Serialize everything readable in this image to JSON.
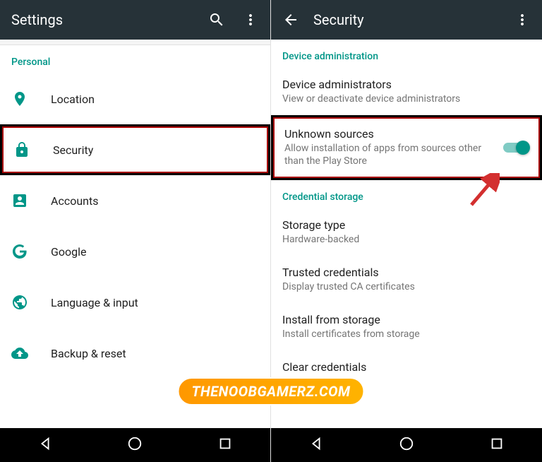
{
  "left": {
    "title": "Settings",
    "section": "Personal",
    "items": [
      {
        "label": "Location"
      },
      {
        "label": "Security"
      },
      {
        "label": "Accounts"
      },
      {
        "label": "Google"
      },
      {
        "label": "Language & input"
      },
      {
        "label": "Backup & reset"
      }
    ]
  },
  "right": {
    "title": "Security",
    "section1": "Device administration",
    "section2": "Credential storage",
    "items": {
      "devadmin": {
        "title": "Device administrators",
        "subtitle": "View or deactivate device administrators"
      },
      "unknown": {
        "title": "Unknown sources",
        "subtitle": "Allow installation of apps from sources other than the Play Store"
      },
      "storage": {
        "title": "Storage type",
        "subtitle": "Hardware-backed"
      },
      "trusted": {
        "title": "Trusted credentials",
        "subtitle": "Display trusted CA certificates"
      },
      "install": {
        "title": "Install from storage",
        "subtitle": "Install certificates from storage"
      },
      "clear": {
        "title": "Clear credentials"
      }
    }
  },
  "watermark": "THENOOBGAMERZ.COM"
}
